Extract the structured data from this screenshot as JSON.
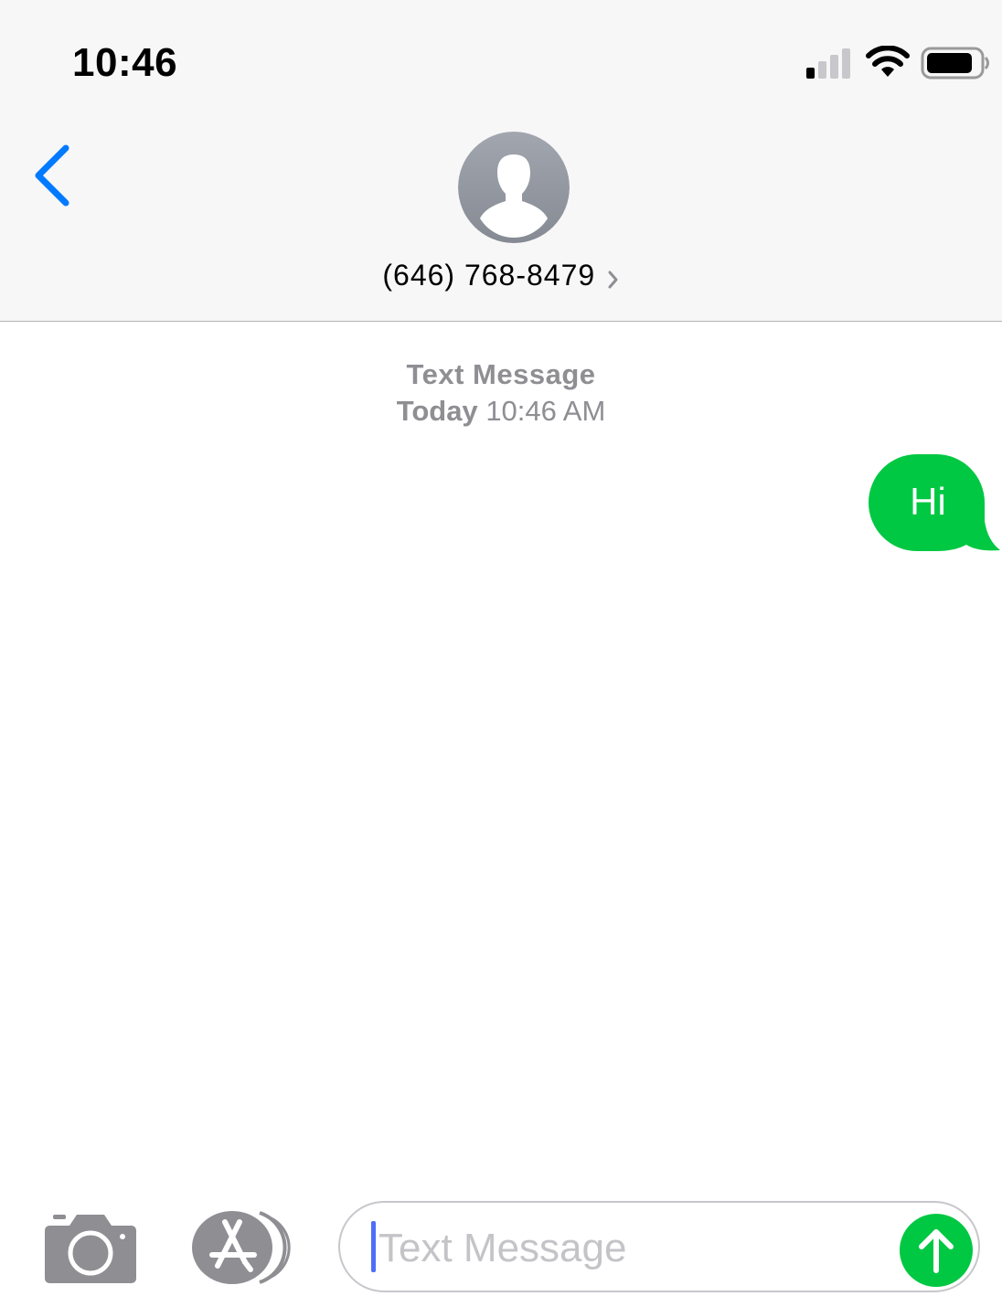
{
  "status_bar": {
    "time": "10:46",
    "signal_icon": "cellular-signal-icon",
    "wifi_icon": "wifi-icon",
    "battery_icon": "battery-icon"
  },
  "header": {
    "back_icon": "chevron-left-icon",
    "avatar_icon": "person-silhouette-icon",
    "contact_number": "(646) 768-8479",
    "contact_chevron_icon": "chevron-right-icon"
  },
  "conversation": {
    "service_label": "Text Message",
    "day_label": "Today",
    "time_label": "10:46 AM",
    "messages": [
      {
        "direction": "outgoing",
        "text": "Hi"
      }
    ]
  },
  "composer": {
    "camera_icon": "camera-icon",
    "apps_icon": "app-store-icon",
    "placeholder": "Text Message",
    "send_icon": "send-arrow-icon"
  },
  "colors": {
    "accent": "#007aff",
    "sms_bubble": "#00c842",
    "meta_text": "#8e8e93",
    "header_background": "#f7f7f7"
  }
}
